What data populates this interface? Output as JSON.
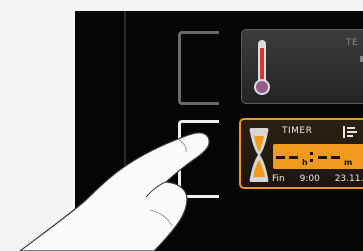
{
  "temperature_card": {
    "title": "TE"
  },
  "timer_card": {
    "title": "TIMER",
    "hours_unit": "h",
    "minutes_unit": "m",
    "finish_label": "Fin",
    "finish_time": "9:00",
    "finish_date": "23.11."
  },
  "colors": {
    "accent": "#f29a1e",
    "panel": "#050505",
    "card": "#2e2e2e"
  },
  "icons": [
    "thermometer-icon",
    "hourglass-icon",
    "list-icon"
  ]
}
